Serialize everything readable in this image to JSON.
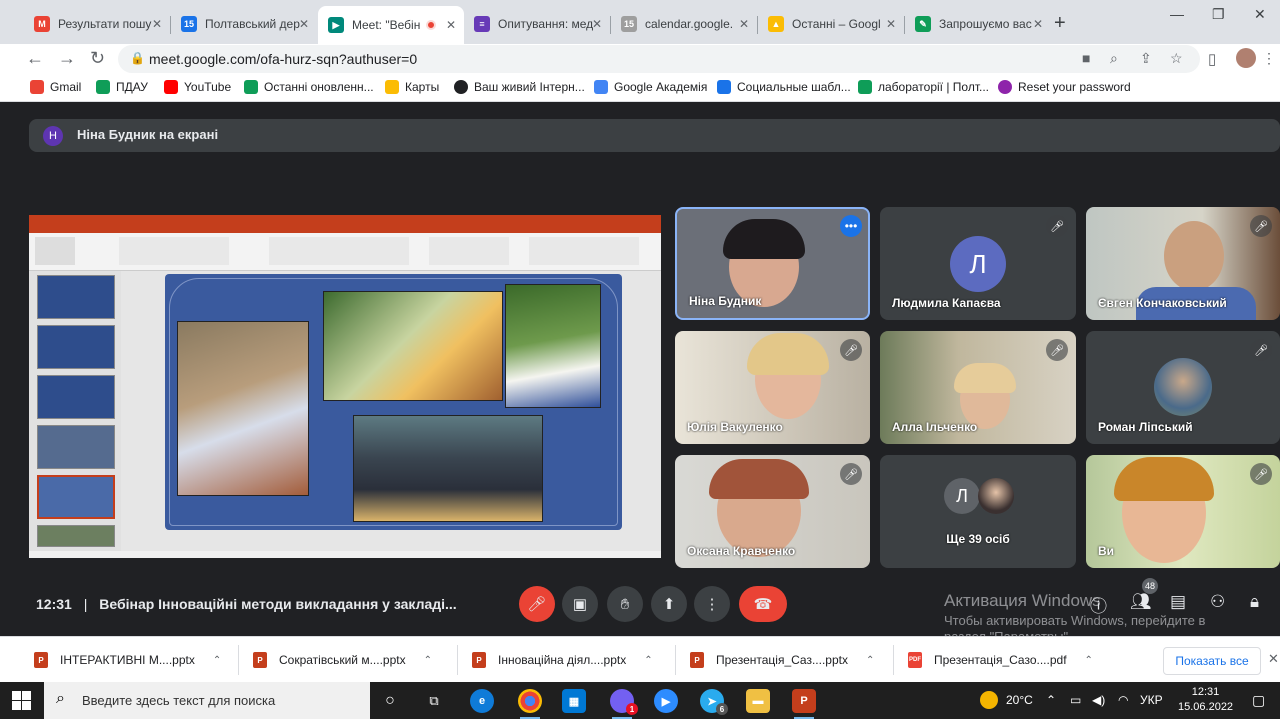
{
  "browser": {
    "tabs": [
      {
        "label": "Результати пошу",
        "color": "#ea4335",
        "icon": "gmail-icon"
      },
      {
        "label": "Полтавський дер",
        "color": "#1a73e8",
        "icon": "calendar-icon"
      },
      {
        "label": "Meet: \"Вебін",
        "color": "#00897b",
        "icon": "meet-icon"
      },
      {
        "label": "Опитування: мед",
        "color": "#673ab7",
        "icon": "forms-icon"
      },
      {
        "label": "calendar.google.",
        "color": "#9e9e9e",
        "icon": "page-icon"
      },
      {
        "label": "Останні – Googl",
        "color": "#fbbc04",
        "icon": "drive-icon"
      },
      {
        "label": "Запрошуємо вас",
        "color": "#0f9d58",
        "icon": "classroom-icon"
      }
    ],
    "url": "meet.google.com/ofa-hurz-sqn?authuser=0",
    "bookmarks": [
      {
        "label": "Gmail",
        "color": "#ea4335"
      },
      {
        "label": "ПДАУ",
        "color": "#0f9d58"
      },
      {
        "label": "YouTube",
        "color": "#ff0000"
      },
      {
        "label": "Останні оновленн...",
        "color": "#0f9d58"
      },
      {
        "label": "Карты",
        "color": "#fbbc04"
      },
      {
        "label": "Ваш живий Інтерн...",
        "color": "#202124"
      },
      {
        "label": "Google Академія",
        "color": "#4285f4"
      },
      {
        "label": "Социальные шабл...",
        "color": "#1a73e8"
      },
      {
        "label": "лабораторії | Полт...",
        "color": "#0f9d58"
      },
      {
        "label": "Reset your password",
        "color": "#8e24aa"
      }
    ]
  },
  "meet": {
    "presenter_initial": "Н",
    "presenter_text": "Ніна Будник на екрані",
    "participants": [
      {
        "name": "Ніна Будник",
        "muted": false
      },
      {
        "name": "Людмила Капаєва",
        "initial": "Л",
        "muted": true
      },
      {
        "name": "Євген Кончаковський",
        "muted": true
      },
      {
        "name": "Юлія Вакуленко",
        "muted": true
      },
      {
        "name": "Алла Ільченко",
        "muted": true
      },
      {
        "name": "Роман Ліпський",
        "muted": true
      },
      {
        "name": "Оксана Кравченко",
        "muted": true
      },
      {
        "name": "Ще 39 осіб",
        "initial": "Л",
        "muted": false
      },
      {
        "name": "Ви",
        "muted": true
      }
    ],
    "meeting_time": "12:31",
    "meeting_title": "Вебінар Інноваційні методи викладання у закладі...",
    "participant_count": "48",
    "activation_title": "Активация Windows",
    "activation_text": "Чтобы активировать Windows, перейдите в раздел \"Параметры\"."
  },
  "downloads": {
    "items": [
      {
        "label": "ІНТЕРАКТИВНІ М....pptx",
        "type": "P",
        "color": "#c43e1c"
      },
      {
        "label": "Сократівський м....pptx",
        "type": "P",
        "color": "#c43e1c"
      },
      {
        "label": "Інноваційна діял....pptx",
        "type": "P",
        "color": "#c43e1c"
      },
      {
        "label": "Презентація_Саз....pptx",
        "type": "P",
        "color": "#c43e1c"
      },
      {
        "label": "Презентація_Сазо....pdf",
        "type": "PDF",
        "color": "#ea4335"
      }
    ],
    "show_all": "Показать все"
  },
  "taskbar": {
    "search_placeholder": "Введите здесь текст для поиска",
    "temperature": "20°C",
    "language": "УКР",
    "time": "12:31",
    "date": "15.06.2022",
    "edge_badge": "6",
    "viber_badge": "1"
  }
}
